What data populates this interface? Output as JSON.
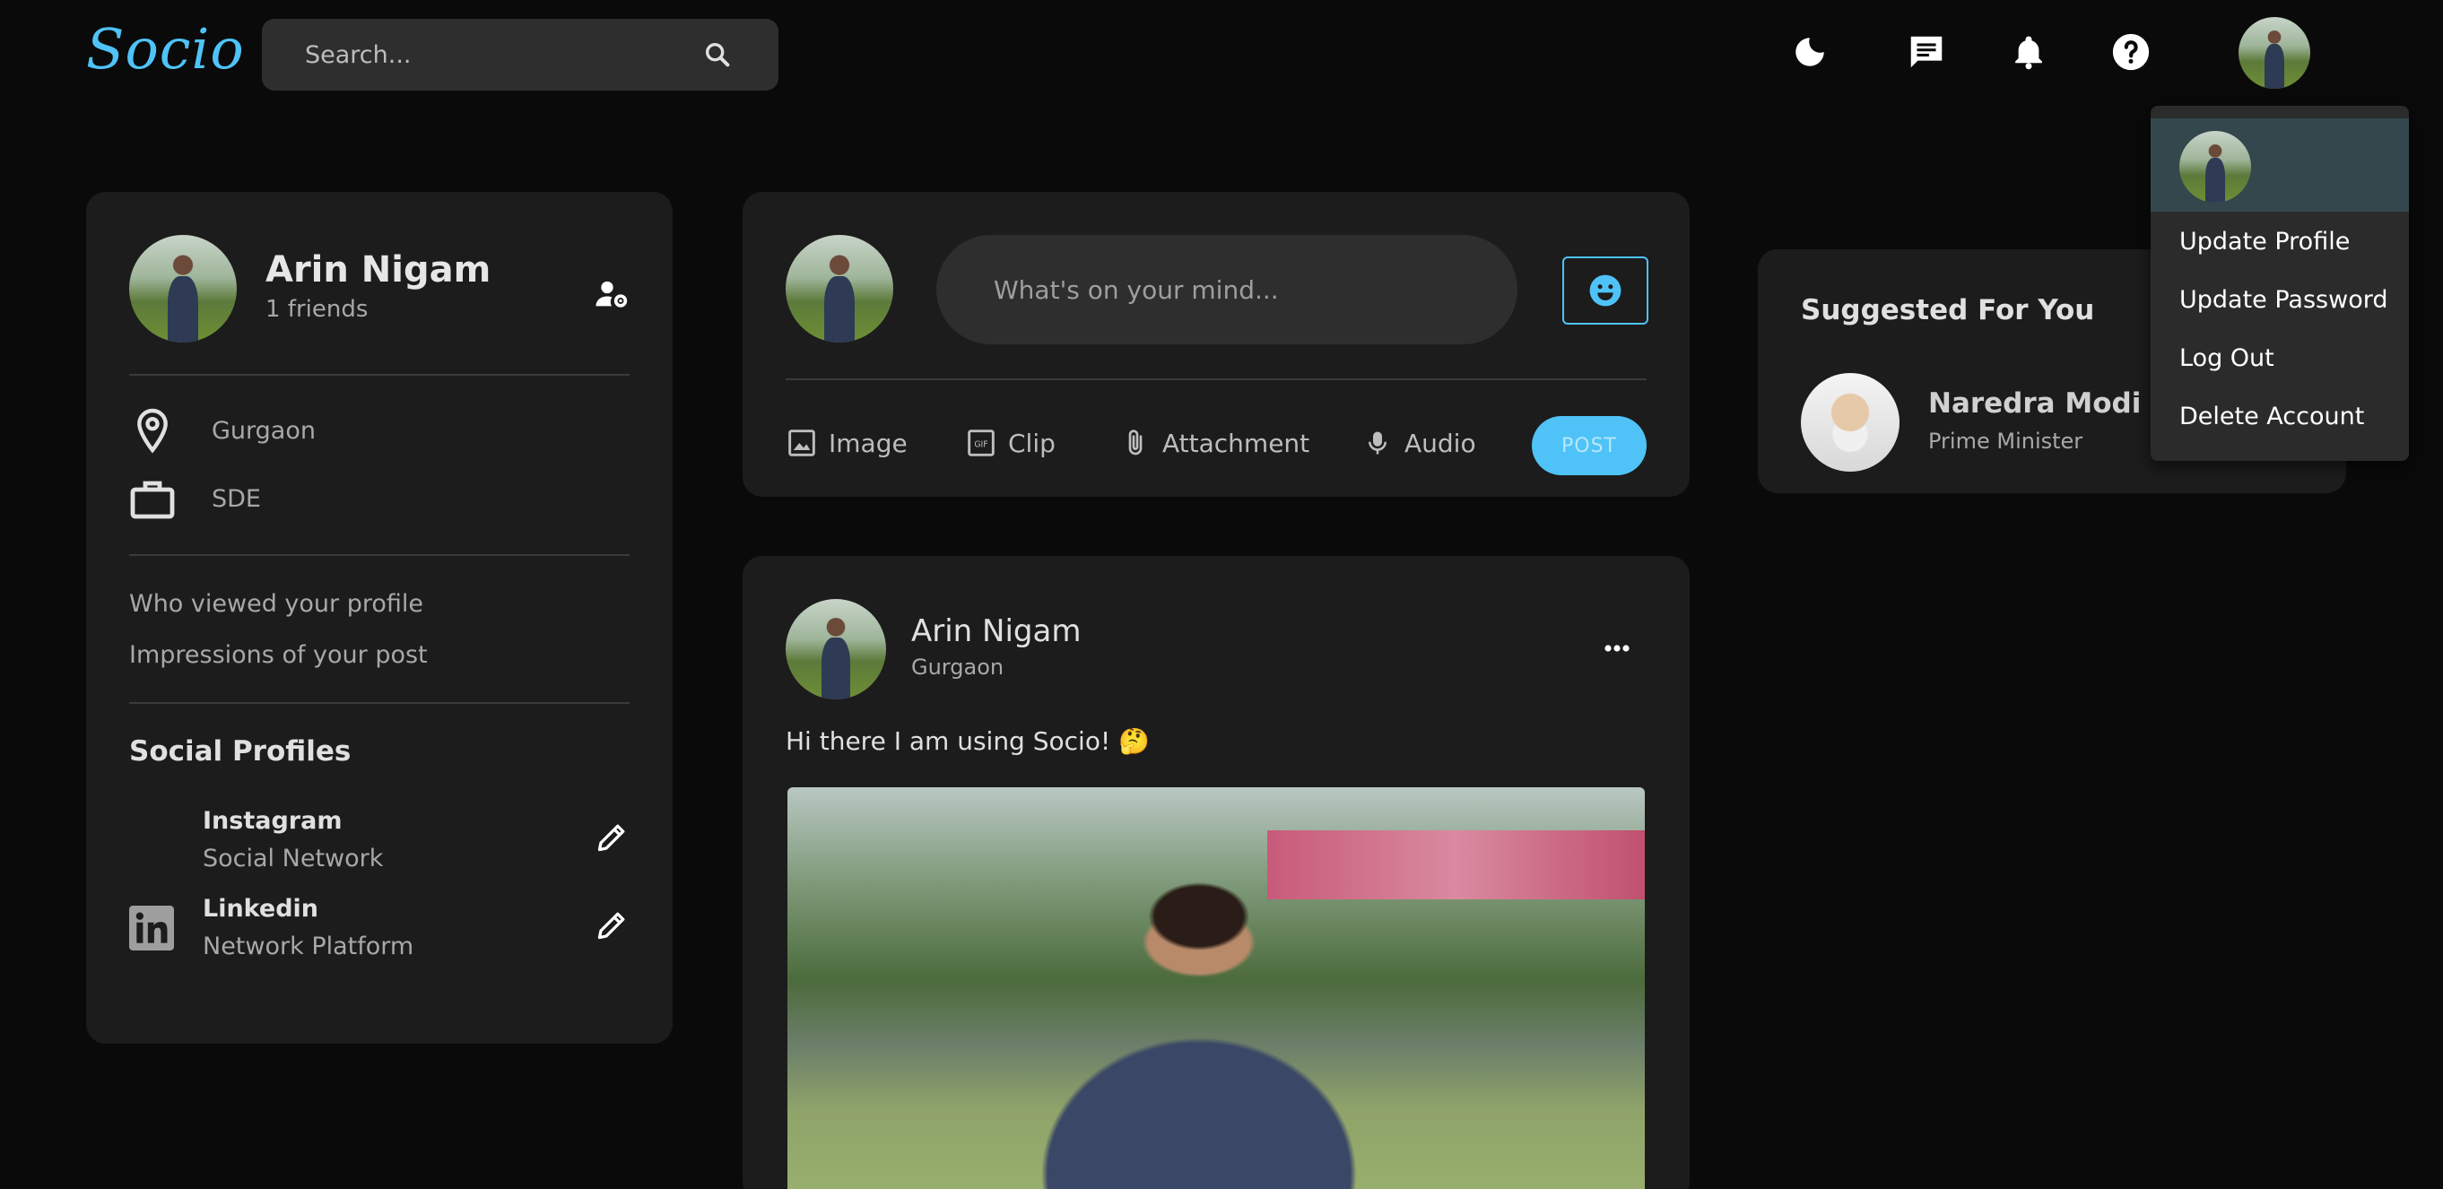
{
  "app": {
    "logo": "Socio"
  },
  "search": {
    "placeholder": "Search..."
  },
  "nav": {
    "icons": [
      "dark-mode-moon-icon",
      "chat-message-icon",
      "notification-bell-icon",
      "help-question-icon"
    ]
  },
  "dropdown": {
    "items": [
      "Update Profile",
      "Update Password",
      "Log Out",
      "Delete Account"
    ]
  },
  "profile": {
    "name": "Arin Nigam",
    "friends": "1 friends",
    "location": "Gurgaon",
    "occupation": "SDE",
    "stats": [
      "Who viewed your profile",
      "Impressions of your post"
    ],
    "social_title": "Social Profiles",
    "socials": [
      {
        "name": "Instagram",
        "sub": "Social Network"
      },
      {
        "name": "Linkedin",
        "sub": "Network Platform"
      }
    ]
  },
  "composer": {
    "placeholder": "What's on your mind...",
    "actions": [
      "Image",
      "Clip",
      "Attachment",
      "Audio"
    ],
    "post_label": "POST"
  },
  "post": {
    "author": "Arin Nigam",
    "location": "Gurgaon",
    "text": "Hi there I am using Socio! 🤔"
  },
  "suggested": {
    "title": "Suggested For You",
    "person": {
      "name": "Naredra Modi",
      "role": "Prime Minister"
    }
  },
  "colors": {
    "accent": "#4fc3f7",
    "background": "#0a0a0a",
    "card": "#1c1c1c"
  }
}
